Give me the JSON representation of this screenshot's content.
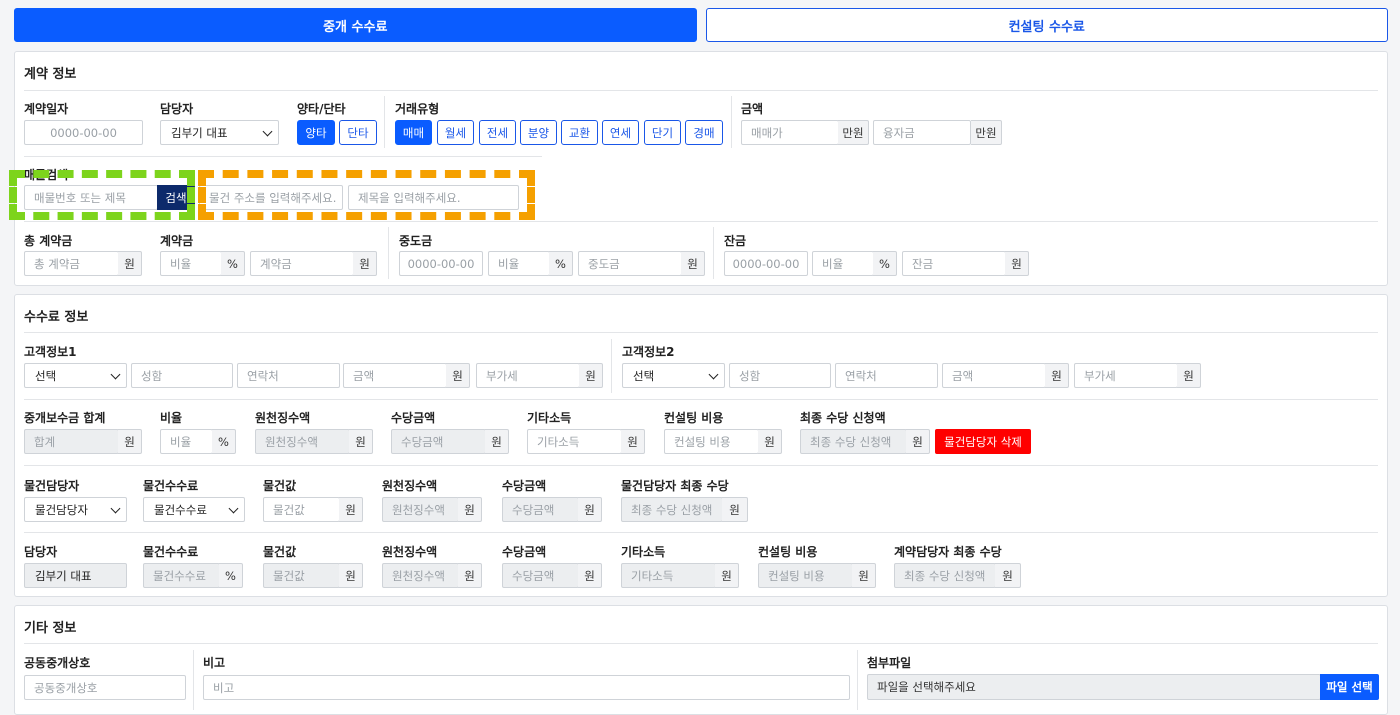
{
  "tabs": {
    "brokerage": "중개 수수료",
    "consulting": "컨설팅 수수료"
  },
  "contract": {
    "title": "계약 정보",
    "date_label": "계약일자",
    "date_placeholder": "0000-00-00",
    "manager_label": "담당자",
    "manager_value": "김부기 대표",
    "side_label": "양타/단타",
    "side_both": "양타",
    "side_single": "단타",
    "type_label": "거래유형",
    "types": [
      "매매",
      "월세",
      "전세",
      "분양",
      "교환",
      "연세",
      "단기",
      "경매"
    ],
    "amount_label": "금액",
    "sale_price_ph": "매매가",
    "unit_manwon": "만원",
    "loan_ph": "융자금",
    "search_label": "매물검색",
    "search_ph": "매물번호 또는 제목",
    "search_btn": "검색",
    "address_ph": "물건 주소를 입력해주세요.",
    "title_ph": "제목을 입력해주세요.",
    "total_deposit_label": "총 계약금",
    "total_deposit_ph": "총 계약금",
    "deposit_label": "계약금",
    "ratio_ph": "비율",
    "pct": "%",
    "deposit_ph": "계약금",
    "middle_label": "중도금",
    "middle_ph": "중도금",
    "balance_label": "잔금",
    "balance_ph": "잔금",
    "won": "원"
  },
  "fee": {
    "title": "수수료 정보",
    "customer1_label": "고객정보1",
    "customer2_label": "고객정보2",
    "select_value": "선택",
    "name_ph": "성함",
    "phone_ph": "연락처",
    "amount_ph": "금액",
    "vat_ph": "부가세",
    "total_label": "중개보수금 합계",
    "total_ph": "합계",
    "ratio_label": "비율",
    "ratio_ph": "비율",
    "withholding_label": "원천징수액",
    "withholding_ph": "원천징수액",
    "allowance_label": "수당금액",
    "allowance_ph": "수당금액",
    "other_income_label": "기타소득",
    "other_income_ph": "기타소득",
    "consult_cost_label": "컨설팅 비용",
    "consult_cost_ph": "컨설팅 비용",
    "final_claim_label": "최종 수당 신청액",
    "final_claim_ph": "최종 수당 신청액",
    "delete_btn": "물건담당자 삭제",
    "prop_manager_label": "물건담당자",
    "prop_manager_value": "물건담당자",
    "prop_fee_label": "물건수수료",
    "prop_fee_value": "물건수수료",
    "prop_value_label": "물건값",
    "prop_value_ph": "물건값",
    "prop_final_label": "물건담당자 최종 수당",
    "manager_label": "담당자",
    "manager_value": "김부기 대표",
    "prop_fee_ph": "물건수수료",
    "contract_final_label": "계약담당자 최종 수당"
  },
  "other": {
    "title": "기타 정보",
    "co_broker_label": "공동중개상호",
    "co_broker_ph": "공동중개상호",
    "note_label": "비고",
    "note_ph": "비고",
    "attach_label": "첨부파일",
    "attach_ph": "파일을 선택해주세요",
    "attach_btn": "파일 선택"
  }
}
